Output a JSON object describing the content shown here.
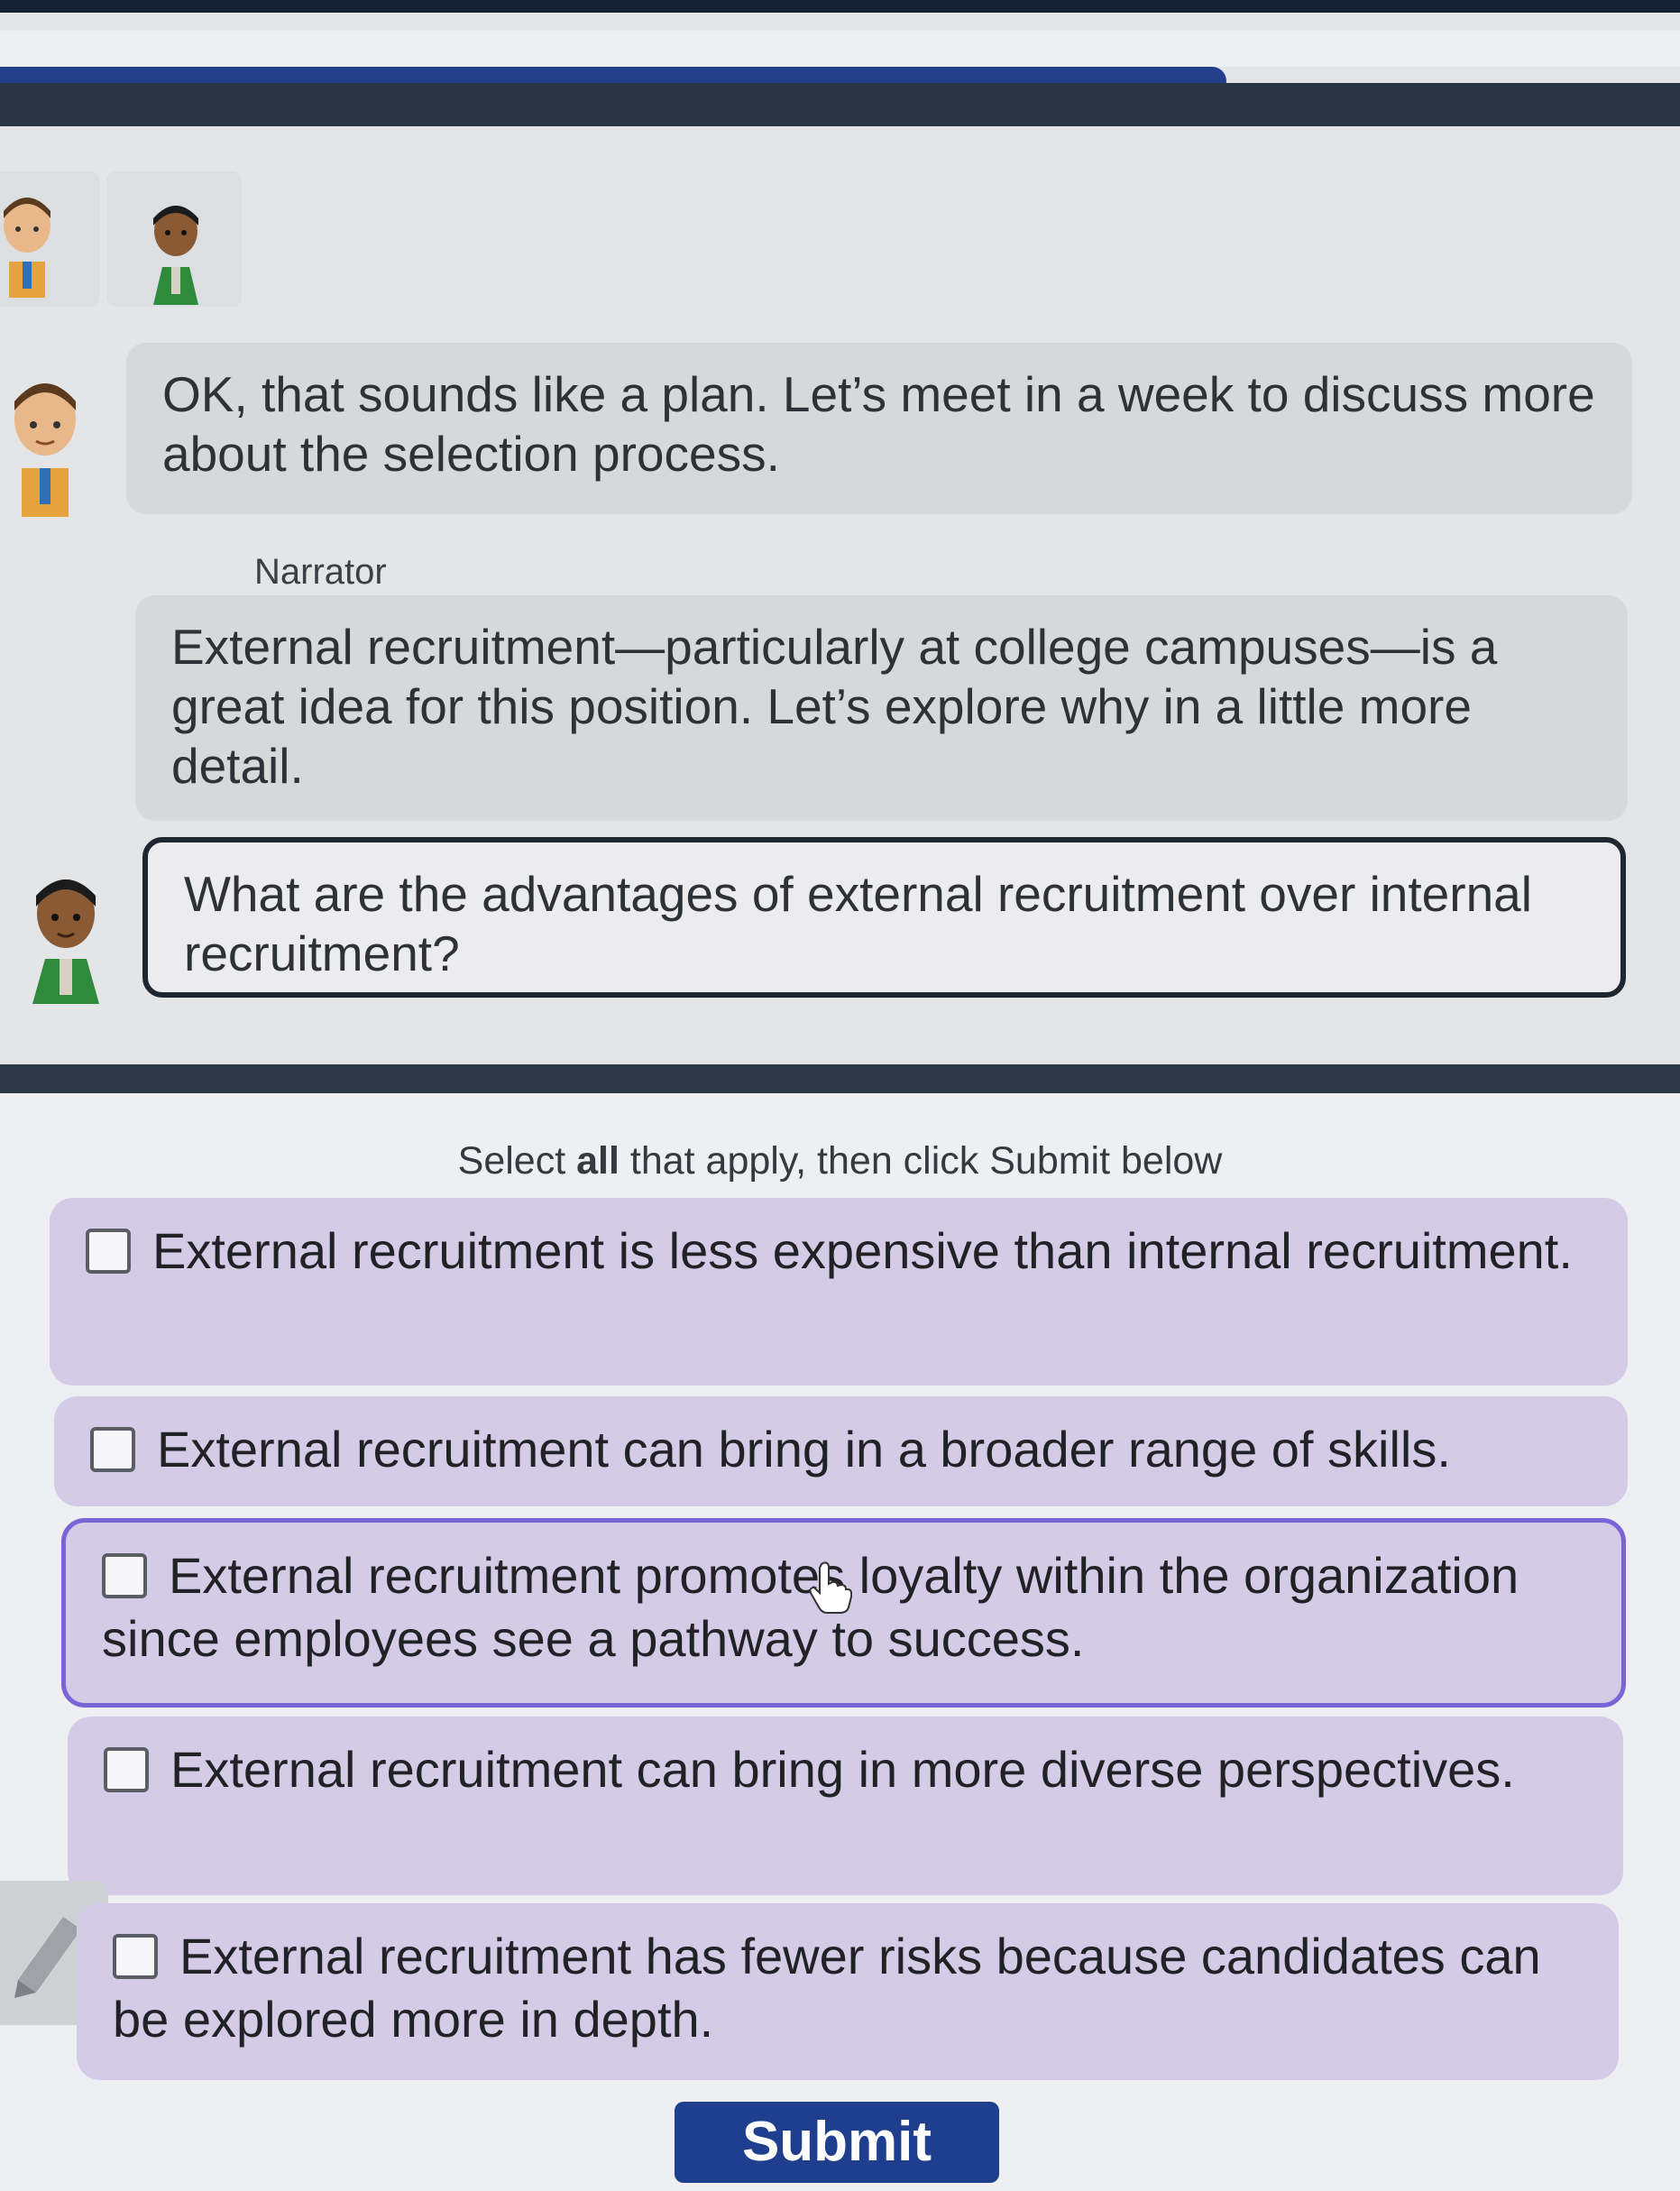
{
  "progress": {
    "fraction": 0.73
  },
  "conversation": {
    "manager_line": "OK, that sounds like a plan. Let’s meet in a week to discuss more about the selection process.",
    "narrator_label": "Narrator",
    "narrator_line": "External recruitment—particularly at college campuses—is a great idea for this position. Let’s explore why in a little more detail.",
    "question": "What are the advantages of external recruitment over internal recruitment?"
  },
  "instructions": {
    "prefix": "Select ",
    "emphasis": "all",
    "suffix": " that apply, then click Submit below"
  },
  "options": [
    {
      "label": "External recruitment is less expensive than internal recruitment.",
      "checked": false
    },
    {
      "label": "External recruitment can bring in a broader range of skills.",
      "checked": false
    },
    {
      "label": "External recruitment promotes loyalty within the organization since employees see a pathway to success.",
      "checked": false
    },
    {
      "label": "External recruitment can bring in more diverse perspectives.",
      "checked": false
    },
    {
      "label": "External recruitment has fewer risks because candidates can be explored more in depth.",
      "checked": false
    }
  ],
  "submit_label": "Submit",
  "colors": {
    "accent": "#233f8c",
    "option_background": "#d4cbe7",
    "selected_border": "#7866d6"
  }
}
